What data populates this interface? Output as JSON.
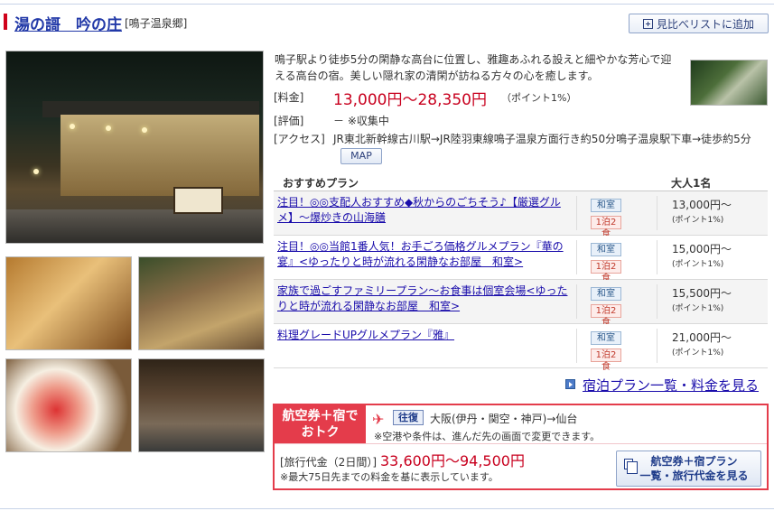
{
  "header": {
    "title": "湯の謌　吟の庄",
    "area": "[鳴子温泉郷]",
    "add_compare": "見比べリストに追加"
  },
  "info": {
    "description": "鳴子駅より徒歩5分の閑静な高台に位置し、雅趣あふれる設えと細やかな芳心で迎える高台の宿。美しい隠れ家の清閑が訪ねる方々の心を癒します。",
    "price_label": "[料金]",
    "price_value": "13,000円〜28,350円",
    "price_point": "（ポイント1%）",
    "rating_label": "[評価]",
    "rating_value": "－ ※収集中",
    "access_label": "[アクセス]",
    "access_value": "JR東北新幹線古川駅→JR陸羽東線鳴子温泉方面行き約50分鳴子温泉駅下車→徒歩約5分",
    "map_label": "MAP"
  },
  "plans": {
    "header_left": "おすすめプラン",
    "header_right": "大人1名",
    "items": [
      {
        "name": "注目！◎◎支配人おすすめ◆秋からのごちそう♪【厳選グルメ】〜爆炒きの山海膳",
        "room": "和室",
        "meal": "1泊2食",
        "price": "13,000円〜",
        "point": "(ポイント1%)"
      },
      {
        "name": "注目！◎◎当館1番人気！お手ごろ価格グルメプラン『華の宴』<ゆったりと時が流れる閑静なお部屋　和室>",
        "room": "和室",
        "meal": "1泊2食",
        "price": "15,000円〜",
        "point": "(ポイント1%)"
      },
      {
        "name": "家族で過ごすファミリープラン〜お食事は個室会場<ゆったりと時が流れる閑静なお部屋　和室>",
        "room": "和室",
        "meal": "1泊2食",
        "price": "15,500円〜",
        "point": "(ポイント1%)"
      },
      {
        "name": "料理グレードUPグルメプラン『雅』",
        "room": "和室",
        "meal": "1泊2食",
        "price": "21,000円〜",
        "point": "(ポイント1%)"
      }
    ],
    "more_link": "宿泊プラン一覧・料金を見る"
  },
  "air": {
    "label_line1": "航空券＋宿で",
    "label_line2": "おトク",
    "roundtrip": "往復",
    "route": "大阪(伊丹・関空・神戸)→仙台",
    "condition": "※空港や条件は、進んだ先の画面で変更できます。",
    "fare_label": "[旅行代金（2日間）]",
    "fare_value": "33,600円〜94,500円",
    "note": "※最大75日先までの料金を基に表示しています。",
    "button_line1": "航空券＋宿プラン",
    "button_line2": "一覧・旅行代金を見る"
  },
  "colors": {
    "accent_red": "#e43c4b",
    "price_red": "#c8001e",
    "link_blue": "#1a0dab"
  }
}
